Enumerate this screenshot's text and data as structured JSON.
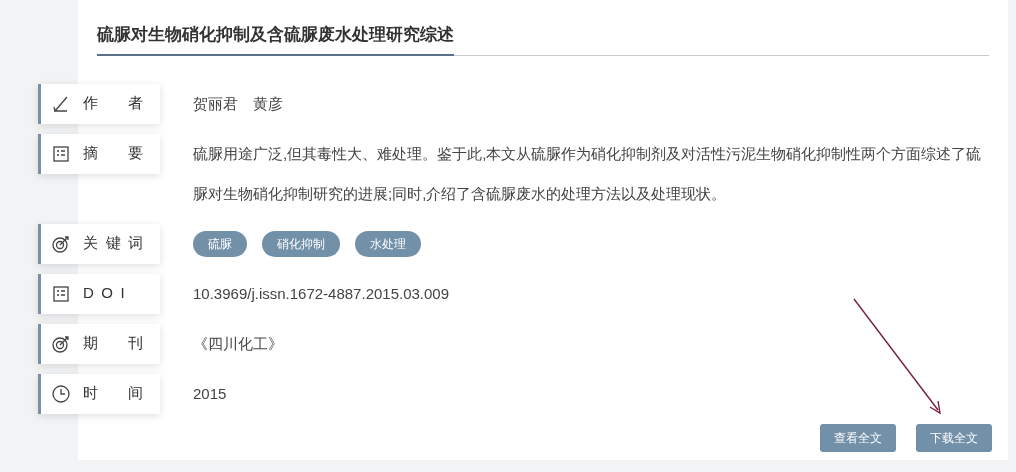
{
  "title": "硫脲对生物硝化抑制及含硫脲废水处理研究综述",
  "fields": [
    {
      "kind": "text",
      "label": "作者",
      "value": "贺丽君　黄彦"
    },
    {
      "kind": "paragraph",
      "label": "摘要",
      "value": "硫脲用途广泛,但其毒性大、难处理。鉴于此,本文从硫脲作为硝化抑制剂及对活性污泥生物硝化抑制性两个方面综述了硫脲对生物硝化抑制研究的进展;同时,介绍了含硫脲废水的处理方法以及处理现状。"
    },
    {
      "kind": "tags",
      "label": "关键词",
      "tags": [
        "硫脲",
        "硝化抑制",
        "水处理"
      ]
    },
    {
      "kind": "text",
      "label": "DOI",
      "value": "10.3969/j.issn.1672-4887.2015.03.009"
    },
    {
      "kind": "text",
      "label": "期刊",
      "value": "《四川化工》"
    },
    {
      "kind": "text",
      "label": "时间",
      "value": "2015"
    }
  ],
  "buttons": [
    "查看全文",
    "下载全文"
  ]
}
